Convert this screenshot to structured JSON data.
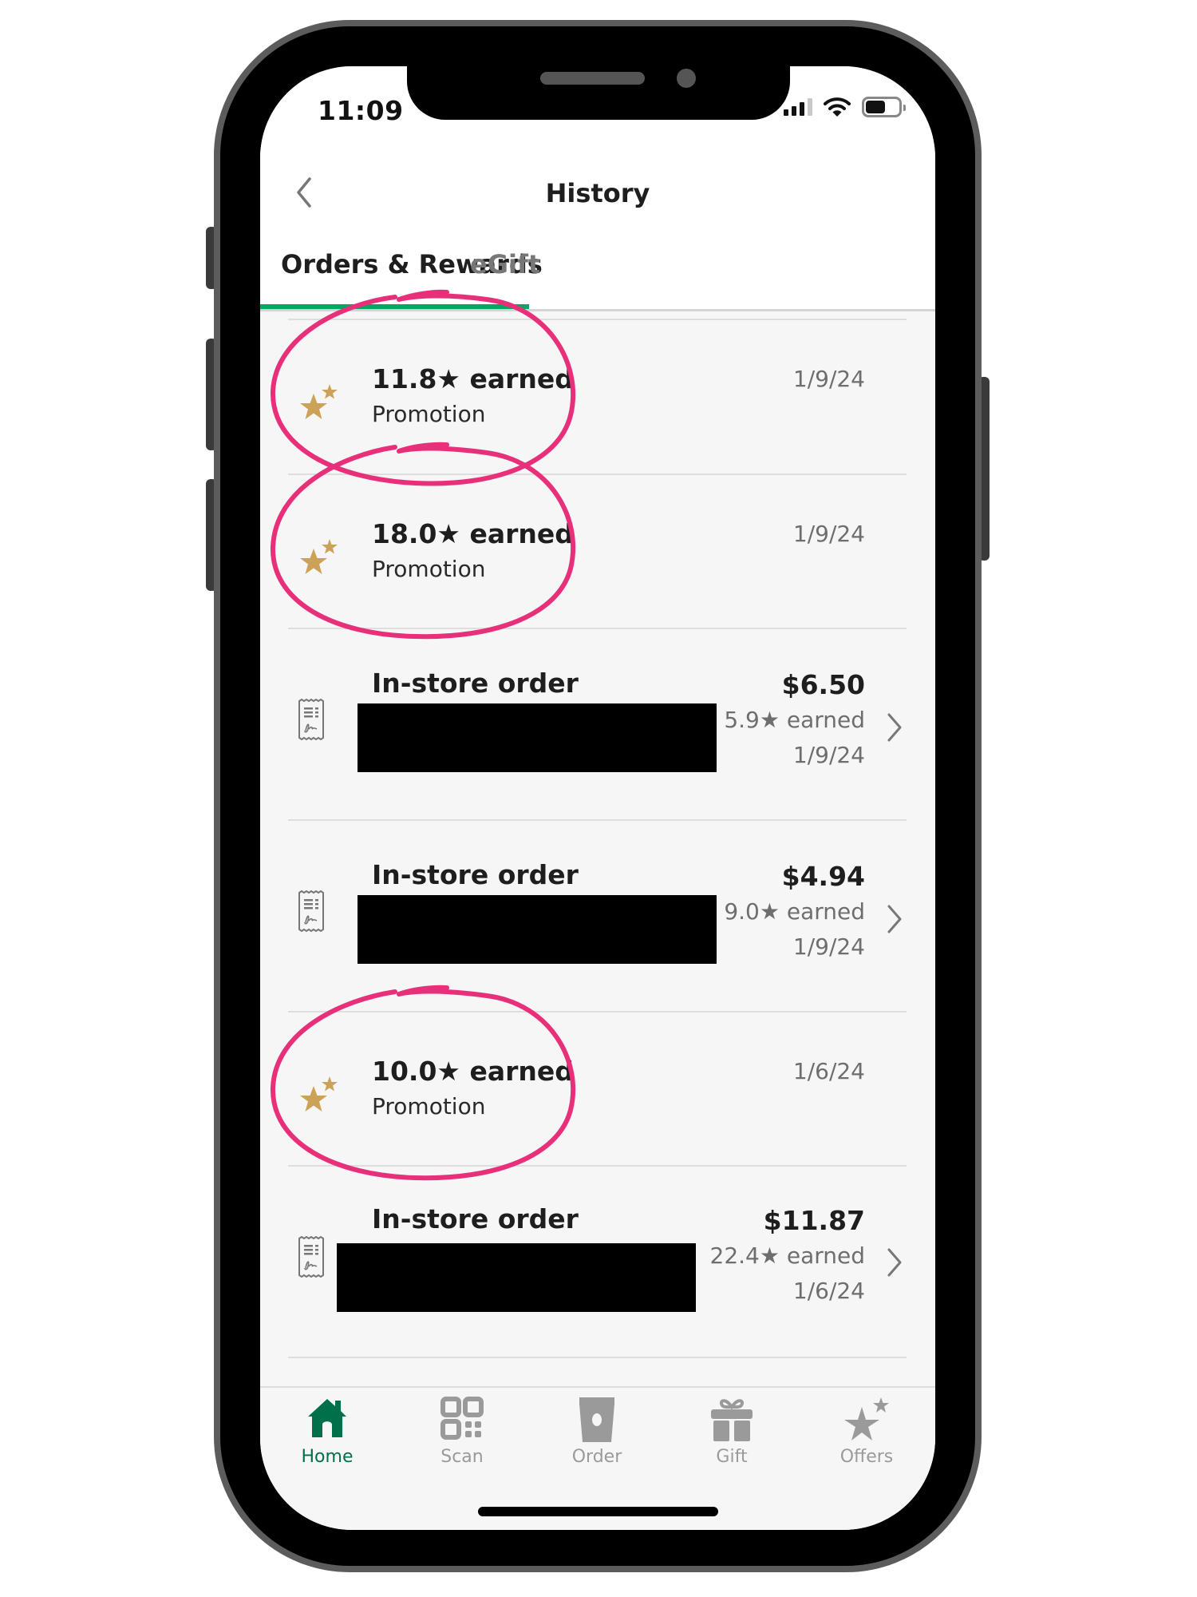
{
  "status_bar": {
    "time": "11:09",
    "signal_bars_filled": 3,
    "signal_bars_total": 4,
    "battery_level": 0.6,
    "icons": [
      "cellular-signal-icon",
      "wifi-icon",
      "battery-icon"
    ]
  },
  "header": {
    "back_icon": "chevron-left-icon",
    "title": "History"
  },
  "tabs": [
    {
      "label": "Orders & Rewards",
      "active": true
    },
    {
      "label": "eGift",
      "active": false
    }
  ],
  "colors": {
    "accent_green": "#00a862",
    "starbucks_green": "#00704a",
    "star_gold": "#cba258",
    "annotation_pink": "#e8307a",
    "inactive_gray": "#9a9a9a"
  },
  "history_items": [
    {
      "type": "promotion",
      "icon": "stars-icon",
      "title": "11.8★ earned",
      "subtitle": "Promotion",
      "date": "1/9/24",
      "annotated": true
    },
    {
      "type": "promotion",
      "icon": "stars-icon",
      "title": "18.0★ earned",
      "subtitle": "Promotion",
      "date": "1/9/24",
      "annotated": true
    },
    {
      "type": "order",
      "icon": "receipt-icon",
      "title": "In-store order",
      "amount": "$6.50",
      "stars": "5.9★ earned",
      "date": "1/9/24",
      "details_redacted": true
    },
    {
      "type": "order",
      "icon": "receipt-icon",
      "title": "In-store order",
      "amount": "$4.94",
      "stars": "9.0★ earned",
      "date": "1/9/24",
      "details_redacted": true
    },
    {
      "type": "promotion",
      "icon": "stars-icon",
      "title": "10.0★ earned",
      "subtitle": "Promotion",
      "date": "1/6/24",
      "annotated": true
    },
    {
      "type": "order",
      "icon": "receipt-icon",
      "title": "In-store order",
      "amount": "$11.87",
      "stars": "22.4★ earned",
      "date": "1/6/24",
      "details_redacted": true
    }
  ],
  "bottom_nav": [
    {
      "label": "Home",
      "icon": "home-icon",
      "active": true
    },
    {
      "label": "Scan",
      "icon": "qr-code-icon",
      "active": false
    },
    {
      "label": "Order",
      "icon": "cup-icon",
      "active": false
    },
    {
      "label": "Gift",
      "icon": "gift-icon",
      "active": false
    },
    {
      "label": "Offers",
      "icon": "offers-stars-icon",
      "active": false
    }
  ]
}
